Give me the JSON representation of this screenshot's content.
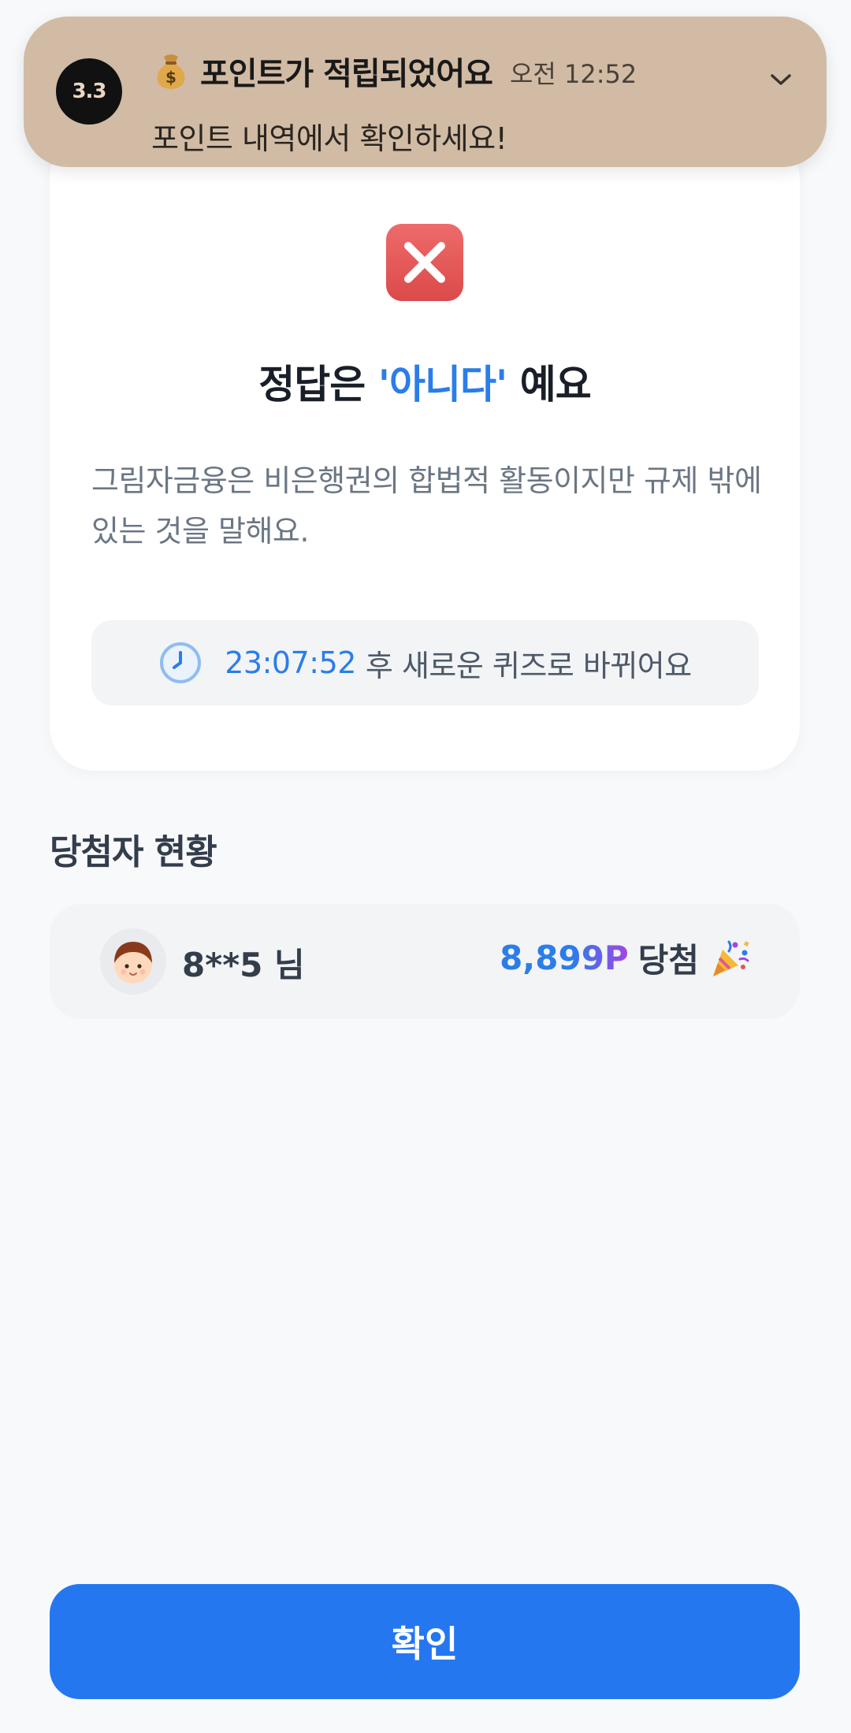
{
  "notification": {
    "app_icon_text": "3.3",
    "title": "포인트가 적립되었어요",
    "time": "오전 12:52",
    "body": "포인트 내역에서 확인하세요!",
    "icon": "money-bag-icon",
    "background_color": "#d1bba5"
  },
  "result": {
    "status_icon": "x-icon",
    "title_prefix": "정답은 ",
    "title_answer": "'아니다'",
    "title_suffix": " 예요",
    "explanation": "그림자금융은 비은행권의 합법적 활동이지만 규제 밖에 있는 것을 말해요.",
    "countdown": "23:07:52",
    "countdown_suffix": "후 새로운 퀴즈로 바뀌어요",
    "accent_color": "#2b7de9",
    "error_color": "#e05555"
  },
  "winners": {
    "title": "당첨자 현황",
    "items": [
      {
        "name": "8**5 님",
        "points": "8,899P",
        "label": "당첨",
        "icon": "party-popper-icon"
      }
    ]
  },
  "confirm_button": {
    "label": "확인",
    "color": "#2577f0"
  }
}
